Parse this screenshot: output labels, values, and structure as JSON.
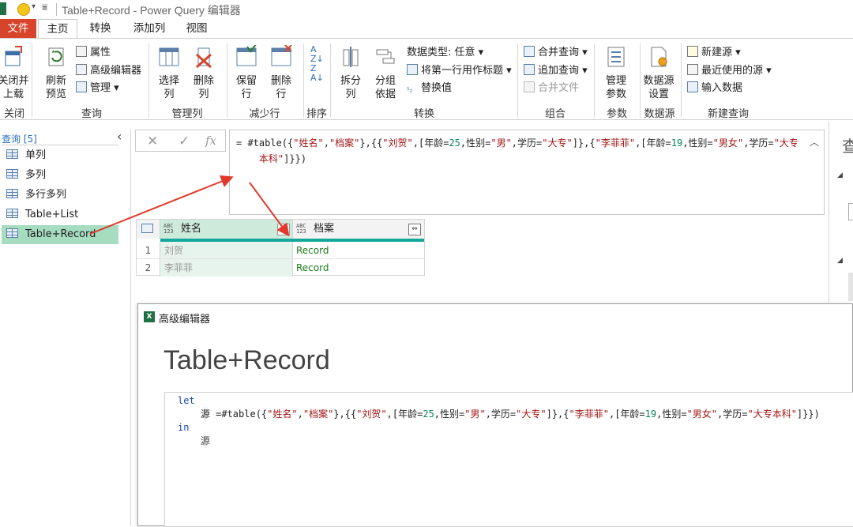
{
  "window": {
    "title": "Table+Record - Power Query 编辑器"
  },
  "tabs": [
    "文件",
    "主页",
    "转换",
    "添加列",
    "视图"
  ],
  "ribbon": {
    "close": {
      "btn": "关闭并\n上载",
      "label": "关闭"
    },
    "query": {
      "refresh": "刷新\n预览",
      "properties": "属性",
      "advanced_editor": "高级编辑器",
      "manage": "管理",
      "label": "查询"
    },
    "manage_cols": {
      "select": "选择\n列",
      "remove": "删除\n列",
      "label": "管理列"
    },
    "reduce_rows": {
      "keep": "保留\n行",
      "remove": "删除\n行",
      "label": "减少行"
    },
    "sort": {
      "label": "排序"
    },
    "transform": {
      "split": "拆分\n列",
      "group": "分组\n依据",
      "data_type": "数据类型: 任意",
      "first_row_header": "将第一行用作标题",
      "replace": "替换值",
      "label": "转换"
    },
    "combine": {
      "merge": "合并查询",
      "append": "追加查询",
      "combine_files": "合并文件",
      "label": "组合"
    },
    "params": {
      "manage": "管理\n参数",
      "label": "参数"
    },
    "datasource": {
      "settings": "数据源\n设置",
      "label": "数据源"
    },
    "new_query": {
      "new_source": "新建源",
      "recent": "最近使用的源",
      "enter_data": "输入数据",
      "label": "新建查询"
    }
  },
  "queries": {
    "header": "查询 [5]",
    "items": [
      "单列",
      "多列",
      "多行多列",
      "Table+List",
      "Table+Record"
    ],
    "selected": "Table+Record"
  },
  "formula_bar": {
    "fx": "fx",
    "parts": [
      "= #table({",
      "\"姓名\"",
      ",",
      "\"档案\"",
      "},{{",
      "\"刘贺\"",
      ",[年龄=",
      "25",
      ",性别=",
      "\"男\"",
      ",学历=",
      "\"大专\"",
      "]},{",
      "\"李菲菲\"",
      ",[年龄=",
      "19",
      ",性别=",
      "\"男女\"",
      ",学历=",
      "\"大专\n    本科\"",
      "]}})"
    ]
  },
  "grid": {
    "type_badge": "ABC\n123",
    "columns": [
      "姓名",
      "档案"
    ],
    "rows": [
      {
        "num": "1",
        "name": "刘贺",
        "record": "Record"
      },
      {
        "num": "2",
        "name": "李菲菲",
        "record": "Record"
      }
    ]
  },
  "right_pane": {
    "title": "查"
  },
  "advanced_editor": {
    "window_title": "高级编辑器",
    "heading": "Table+Record",
    "code": {
      "let": "let",
      "line2_prefix": "    源 =#table({",
      "line2_parts": [
        "\"姓名\"",
        ",",
        "\"档案\"",
        "},{{",
        "\"刘贺\"",
        ",[年龄=",
        "25",
        ",性别=",
        "\"男\"",
        ",学历=",
        "\"大专\"",
        "]},{",
        "\"李菲菲\"",
        ",[年龄=",
        "19",
        ",性别=",
        "\"男女\"",
        ",学历=",
        "\"大专本科\"",
        "]}})"
      ],
      "in": "in",
      "result": "    源"
    }
  },
  "colors": {
    "accent_green": "#1e7145",
    "file_tab": "#d8432b",
    "selection": "#a6dcc0",
    "arrow": "#e03a2c",
    "teal": "#14a89a"
  }
}
